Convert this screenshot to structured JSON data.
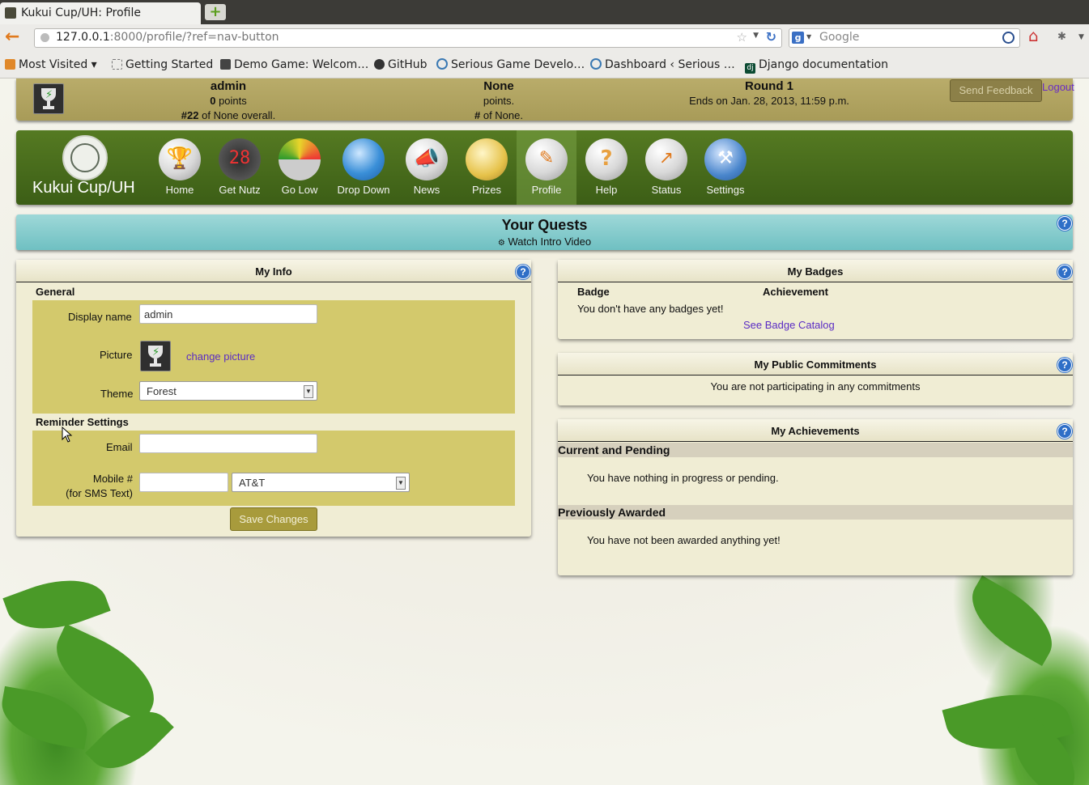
{
  "browser": {
    "tab_title": "Kukui Cup/UH: Profile",
    "url_host": "127.0.0.1",
    "url_rest": ":8000/profile/?ref=nav-button",
    "search_placeholder": "Google",
    "bookmarks": [
      "Most Visited",
      "Getting Started",
      "Demo Game: Welcom…",
      "GitHub",
      "Serious Game Develo…",
      "Dashboard ‹ Serious …",
      "Django documentation"
    ]
  },
  "topbar": {
    "user": {
      "name": "admin",
      "points_value": "0",
      "points_label": "points",
      "rank": "#22",
      "rank_suffix": "of None overall."
    },
    "team": {
      "name": "None",
      "points_label": "points.",
      "rank": "#",
      "rank_suffix": "of None."
    },
    "round": {
      "title": "Round 1",
      "ends": "Ends on Jan. 28, 2013, 11:59 p.m."
    },
    "feedback_label": "Send Feedback",
    "logout_label": "Logout"
  },
  "nav": {
    "brand": "Kukui Cup/UH",
    "items": [
      {
        "label": "Home",
        "icon": "trophy-icon"
      },
      {
        "label": "Get Nutz",
        "icon": "scoreboard-icon"
      },
      {
        "label": "Go Low",
        "icon": "gauge-icon"
      },
      {
        "label": "Drop Down",
        "icon": "water-drop-icon"
      },
      {
        "label": "News",
        "icon": "megaphone-icon"
      },
      {
        "label": "Prizes",
        "icon": "ribbon-icon"
      },
      {
        "label": "Profile",
        "icon": "profile-card-icon"
      },
      {
        "label": "Help",
        "icon": "question-icon"
      },
      {
        "label": "Status",
        "icon": "chart-icon"
      },
      {
        "label": "Settings",
        "icon": "wrench-icon"
      }
    ],
    "active": "Profile"
  },
  "quests": {
    "title": "Your Quests",
    "item": "Watch Intro Video"
  },
  "my_info": {
    "title": "My Info",
    "general_label": "General",
    "display_name_label": "Display name",
    "display_name_value": "admin",
    "picture_label": "Picture",
    "change_picture_label": "change picture",
    "theme_label": "Theme",
    "theme_value": "Forest",
    "reminder_label": "Reminder Settings",
    "email_label": "Email",
    "email_value": "",
    "mobile_label": "Mobile #",
    "mobile_sub_label": "(for SMS Text)",
    "mobile_value": "",
    "carrier_value": "AT&T",
    "save_label": "Save Changes"
  },
  "my_badges": {
    "title": "My Badges",
    "col_badge": "Badge",
    "col_achievement": "Achievement",
    "empty_text": "You don't have any badges yet!",
    "catalog_link": "See Badge Catalog"
  },
  "commitments": {
    "title": "My Public Commitments",
    "empty_text": "You are not participating in any commitments"
  },
  "achievements": {
    "title": "My Achievements",
    "current_label": "Current and Pending",
    "current_text": "You have nothing in progress or pending.",
    "previous_label": "Previously Awarded",
    "previous_text": "You have not been awarded anything yet!"
  },
  "help_glyph": "?"
}
